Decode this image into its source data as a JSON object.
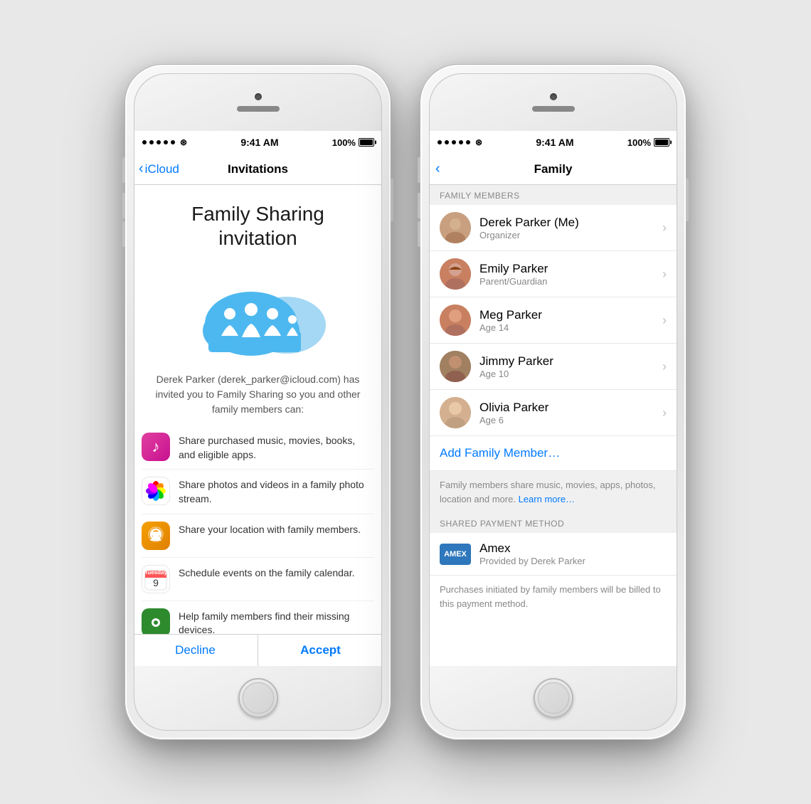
{
  "phone1": {
    "status": {
      "time": "9:41 AM",
      "battery": "100%"
    },
    "nav": {
      "back_label": "iCloud",
      "title": "Invitations"
    },
    "invitation": {
      "title": "Family Sharing\ninvitation",
      "body": "Derek Parker (derek_parker@icloud.com) has invited you to Family Sharing so you and other family members can:",
      "features": [
        {
          "icon": "music",
          "text": "Share purchased music, movies, books, and eligible apps."
        },
        {
          "icon": "photos",
          "text": "Share photos and videos in a family photo stream."
        },
        {
          "icon": "location",
          "text": "Share your location with family members."
        },
        {
          "icon": "calendar",
          "text": "Schedule events on the family calendar."
        },
        {
          "icon": "findmy",
          "text": "Help family members find their missing devices."
        }
      ]
    },
    "actions": {
      "decline": "Decline",
      "accept": "Accept"
    }
  },
  "phone2": {
    "status": {
      "time": "9:41 AM",
      "battery": "100%"
    },
    "nav": {
      "title": "Family"
    },
    "sections": {
      "family_members_header": "FAMILY MEMBERS",
      "payment_header": "SHARED PAYMENT METHOD"
    },
    "members": [
      {
        "name": "Derek Parker (Me)",
        "role": "Organizer",
        "avatar": "derek"
      },
      {
        "name": "Emily Parker",
        "role": "Parent/Guardian",
        "avatar": "emily"
      },
      {
        "name": "Meg Parker",
        "role": "Age 14",
        "avatar": "meg"
      },
      {
        "name": "Jimmy Parker",
        "role": "Age 10",
        "avatar": "jimmy"
      },
      {
        "name": "Olivia Parker",
        "role": "Age 6",
        "avatar": "olivia"
      }
    ],
    "add_member": "Add Family Member…",
    "family_info": "Family members share music, movies, apps, photos, location and more.",
    "learn_more": "Learn more…",
    "payment": {
      "name": "Amex",
      "provided_by": "Provided by Derek Parker",
      "note": "Purchases initiated by family members will be billed to this payment method."
    }
  }
}
